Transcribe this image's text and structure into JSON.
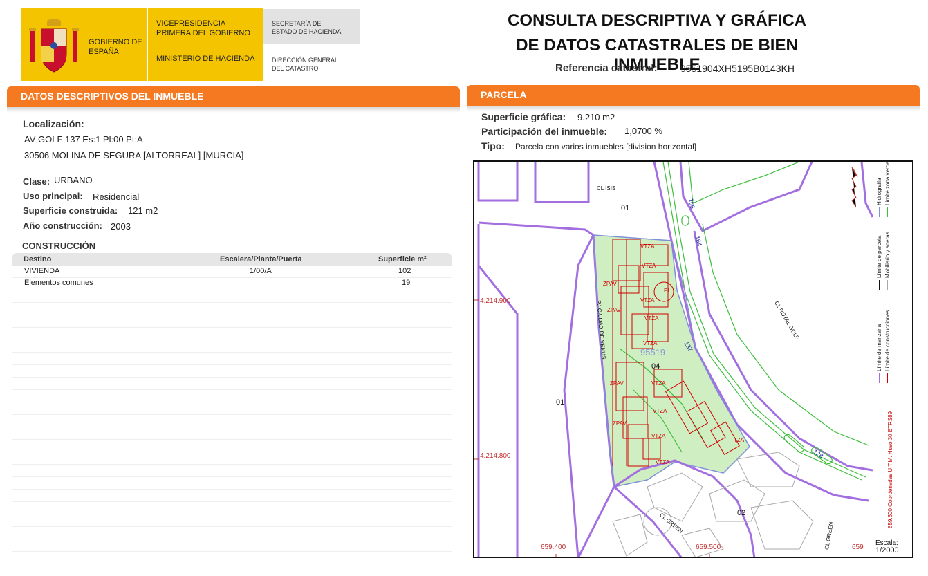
{
  "header": {
    "gov_name": "GOBIERNO DE ESPAÑA",
    "vicepresidencia": "VICEPRESIDENCIA PRIMERA DEL GOBIERNO",
    "ministerio": "MINISTERIO DE HACIENDA",
    "secretaria": "SECRETARÍA DE ESTADO DE HACIENDA",
    "direccion": "DIRECCIÓN GENERAL DEL CATASTRO",
    "title_line1": "CONSULTA DESCRIPTIVA Y GRÁFICA",
    "title_line2": "DE DATOS CATASTRALES DE BIEN INMUEBLE",
    "ref_label": "Referencia catastral:",
    "ref_value": "9551904XH5195B0143KH"
  },
  "left": {
    "section_title": "DATOS DESCRIPTIVOS DEL INMUEBLE",
    "localizacion_label": "Localización:",
    "address_line1": "AV GOLF 137 Es:1 Pl:00 Pt:A",
    "address_line2": "30506 MOLINA DE SEGURA [ALTORREAL] [MURCIA]",
    "clase_label": "Clase:",
    "clase_value": "URBANO",
    "uso_label": "Uso principal:",
    "uso_value": "Residencial",
    "superficie_label": "Superficie construida:",
    "superficie_value": "121 m2",
    "anio_label": "Año construcción:",
    "anio_value": "2003",
    "construccion_title": "CONSTRUCCIÓN",
    "table": {
      "headers": [
        "Destino",
        "Escalera/Planta/Puerta",
        "Superficie m²"
      ],
      "rows": [
        [
          "VIVIENDA",
          "1/00/A",
          "102"
        ],
        [
          "Elementos comunes",
          "",
          "19"
        ]
      ]
    }
  },
  "right": {
    "section_title": "PARCELA",
    "superficie_label": "Superficie gráfica:",
    "superficie_value": "9.210 m2",
    "participacion_label": "Participación del inmueble:",
    "participacion_value": "1,0700 %",
    "tipo_label": "Tipo:",
    "tipo_value": "Parcela con varios inmuebles [division horizontal]"
  },
  "map": {
    "labels": {
      "cl_isis": "CL ISIS",
      "n01_top": "01",
      "n01_left": "01",
      "n02": "02",
      "n04": "04",
      "parcel_code": "95519",
      "cl_royal": "CL ROYAL GOLF",
      "cl_green": "CL GREEN",
      "cl_green2": "CL GREEN",
      "pasaje": "PJ CIUDAD DE VENUS"
    },
    "numbers": {
      "n166": "166",
      "n164": "164",
      "n137": "137",
      "n128": "128"
    },
    "coords": {
      "y1": "4.214.900",
      "y2": "4.214.800",
      "x1": "659.400",
      "x2": "659.500",
      "x3": "659"
    },
    "legend": {
      "manzana": "Límite de manzana",
      "parcela": "Límite de parcela",
      "hidrografia": "Hidrografía",
      "construcciones": "Límite de construcciones",
      "mobiliario": "Mobiliario y aceras",
      "zona_verde": "Límite zona verde"
    },
    "coord_note": "659.600 Coordenadas U.T.M. Huso 30 ETRS89",
    "scale_label": "Escala:",
    "scale_value": "1/2000",
    "building_tags": [
      "VTZA",
      "VTZA",
      "VTZA",
      "VTZA",
      "PI",
      "ZPAV",
      "ZPAV",
      "VTZA",
      "ZPAV",
      "VTZA",
      "ZPAV",
      "VTZA",
      "VTZA",
      "VTZA",
      "TZA"
    ],
    "colors": {
      "manzana": "#a36ee0",
      "construccion": "#d00000",
      "zona_verde": "#3cbf3c",
      "parcela_fill": "#cfeec2"
    }
  }
}
